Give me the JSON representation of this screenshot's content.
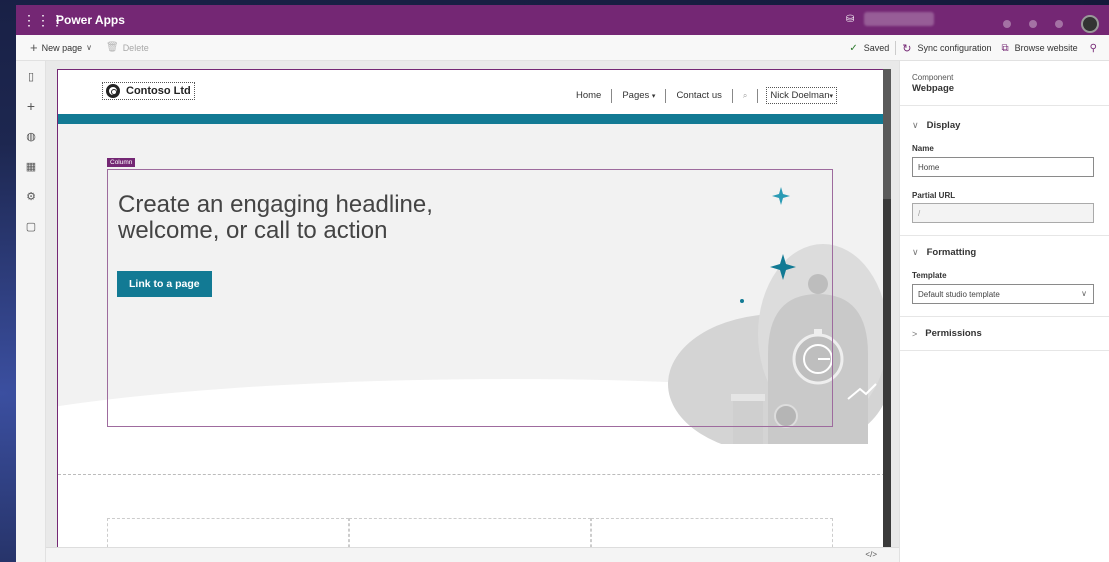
{
  "app": {
    "name": "Power Apps",
    "waffle_icon": "waffle-icon"
  },
  "command_bar": {
    "new_page": "New page",
    "delete": "Delete",
    "saved": "Saved",
    "sync": "Sync configuration",
    "browse": "Browse website"
  },
  "site": {
    "logo_text": "Contoso Ltd",
    "nav": {
      "home": "Home",
      "pages": "Pages",
      "contact": "Contact us",
      "user": "Nick Doelman"
    },
    "column_tag": "Column",
    "headline": "Create an engaging headline, welcome, or call to action",
    "cta": "Link to a page"
  },
  "panel": {
    "component_label": "Component",
    "component_name": "Webpage",
    "display_section": "Display",
    "name_label": "Name",
    "name_value": "Home",
    "partial_url_label": "Partial URL",
    "partial_url_value": "/",
    "formatting_section": "Formatting",
    "template_label": "Template",
    "template_value": "Default studio template",
    "permissions_section": "Permissions"
  },
  "bottom_bar": {
    "code_toggle": "</>"
  },
  "colors": {
    "brand": "#742774",
    "teal": "#127a94"
  }
}
